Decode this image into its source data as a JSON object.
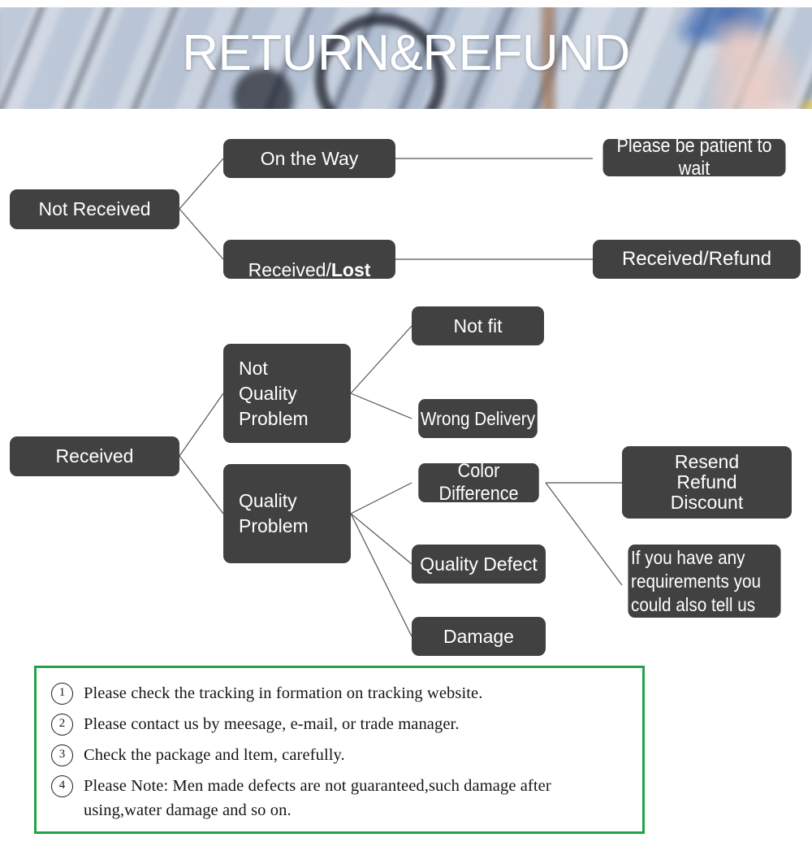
{
  "banner": {
    "title": "RETURN&REFUND",
    "background_description": "blurred-deck-bicycle-photo"
  },
  "colors": {
    "node_bg": "#414141",
    "node_text": "#ffffff",
    "connector": "#555555",
    "notes_border": "#22a349",
    "page_bg": "#ffffff"
  },
  "flowchart": {
    "nodes": [
      {
        "id": "not-received",
        "label": "Not Received"
      },
      {
        "id": "on-the-way",
        "label": "On the Way"
      },
      {
        "id": "received-lost-pre",
        "label": "Received/"
      },
      {
        "id": "received-lost-bold",
        "label": "Lost"
      },
      {
        "id": "please-be-patient",
        "label": "Please be patient to wait"
      },
      {
        "id": "received-refund",
        "label": "Received/Refund"
      },
      {
        "id": "received",
        "label": "Received"
      },
      {
        "id": "not-quality-problem",
        "label": "Not\nQuality\nProblem"
      },
      {
        "id": "quality-problem",
        "label": "Quality\nProblem"
      },
      {
        "id": "not-fit",
        "label": "Not fit"
      },
      {
        "id": "wrong-delivery",
        "label": "Wrong Delivery"
      },
      {
        "id": "color-difference",
        "label": "Color Difference"
      },
      {
        "id": "quality-defect",
        "label": "Quality Defect"
      },
      {
        "id": "damage",
        "label": "Damage"
      },
      {
        "id": "resend-refund-discount",
        "label": "Resend\nRefund\nDiscount"
      },
      {
        "id": "if-you-have-any-requirements",
        "label": "If you have any\nrequirements you\ncould also tell us"
      }
    ]
  },
  "notes": {
    "items": [
      {
        "number": "1",
        "text": "Please check the tracking in formation on tracking website."
      },
      {
        "number": "2",
        "text": "Please contact us by meesage, e-mail, or trade manager."
      },
      {
        "number": "3",
        "text": "Check the package and ltem, carefully."
      },
      {
        "number": "4",
        "text": "Please Note: Men made defects  are not guaranteed,such damage after using,water damage and so on."
      }
    ]
  }
}
